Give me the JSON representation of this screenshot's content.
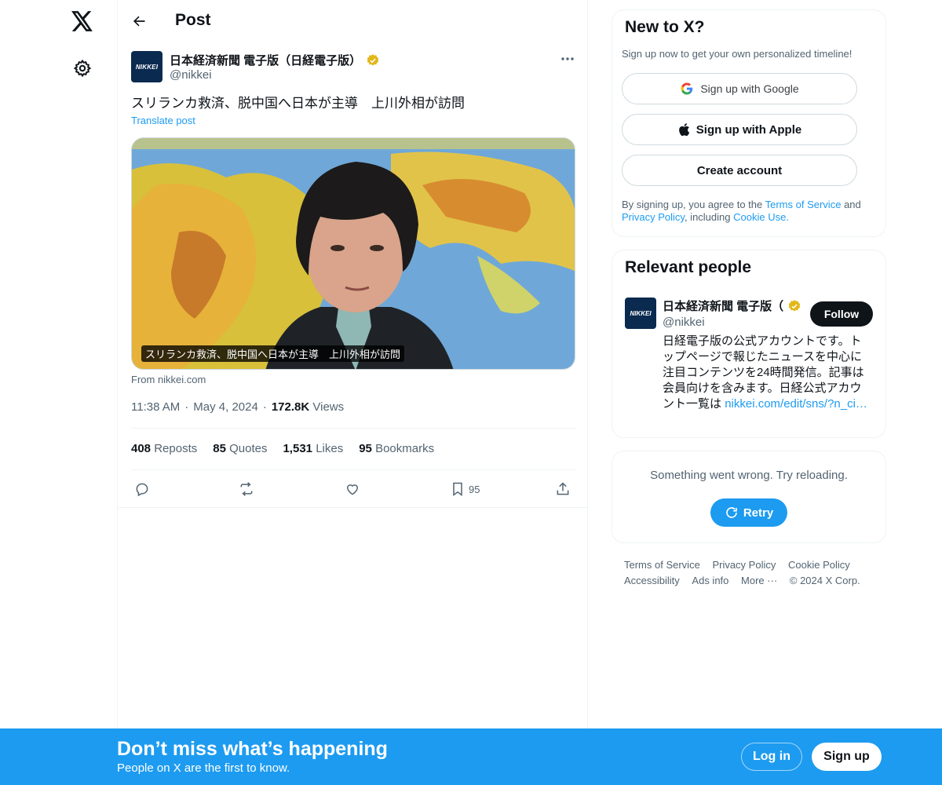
{
  "header": {
    "title": "Post"
  },
  "post": {
    "author_name": "日本経済新聞 電子版（日経電子版）",
    "author_handle": "@nikkei",
    "avatar_text": "NIKKEI",
    "text": "スリランカ救済、脱中国へ日本が主導　上川外相が訪問",
    "translate_label": "Translate post",
    "media_caption": "スリランカ救済、脱中国へ日本が主導　上川外相が訪問",
    "source": "From nikkei.com",
    "time": "11:38 AM",
    "date": "May 4, 2024",
    "views_count": "172.8K",
    "views_label": "Views",
    "stats": {
      "reposts_count": "408",
      "reposts_label": "Reposts",
      "quotes_count": "85",
      "quotes_label": "Quotes",
      "likes_count": "1,531",
      "likes_label": "Likes",
      "bookmarks_count": "95",
      "bookmarks_label": "Bookmarks"
    },
    "bookmark_action_count": "95"
  },
  "signup_card": {
    "title": "New to X?",
    "subtitle": "Sign up now to get your own personalized timeline!",
    "google_label": "Sign up with Google",
    "apple_label": "Sign up with Apple",
    "create_label": "Create account",
    "legal_prefix": "By signing up, you agree to the",
    "terms_label": "Terms of Service",
    "legal_and": "and",
    "privacy_label": "Privacy Policy",
    "legal_including": ", including",
    "cookie_label": "Cookie Use."
  },
  "relevant_people": {
    "title": "Relevant people",
    "name": "日本経済新聞 電子版（",
    "handle": "@nikkei",
    "avatar_text": "NIKKEI",
    "follow_label": "Follow",
    "bio": "日経電子版の公式アカウントです。トップページで報じたニュースを中心に注目コンテンツを24時間発信。記事は会員向けを含みます。日経公式アカウント一覧は",
    "bio_link": "nikkei.com/edit/sns/?n_ci…"
  },
  "error_card": {
    "message": "Something went wrong. Try reloading.",
    "retry_label": "Retry"
  },
  "footer": {
    "links": [
      "Terms of Service",
      "Privacy Policy",
      "Cookie Policy",
      "Accessibility",
      "Ads info",
      "More ···",
      "© 2024 X Corp."
    ]
  },
  "banner": {
    "title": "Don’t miss what’s happening",
    "subtitle": "People on X are the first to know.",
    "login_label": "Log in",
    "signup_label": "Sign up"
  },
  "colors": {
    "accent": "#1d9bf0",
    "text_primary": "#0f1419",
    "text_secondary": "#536471",
    "verified_gold": "#e2b719"
  }
}
